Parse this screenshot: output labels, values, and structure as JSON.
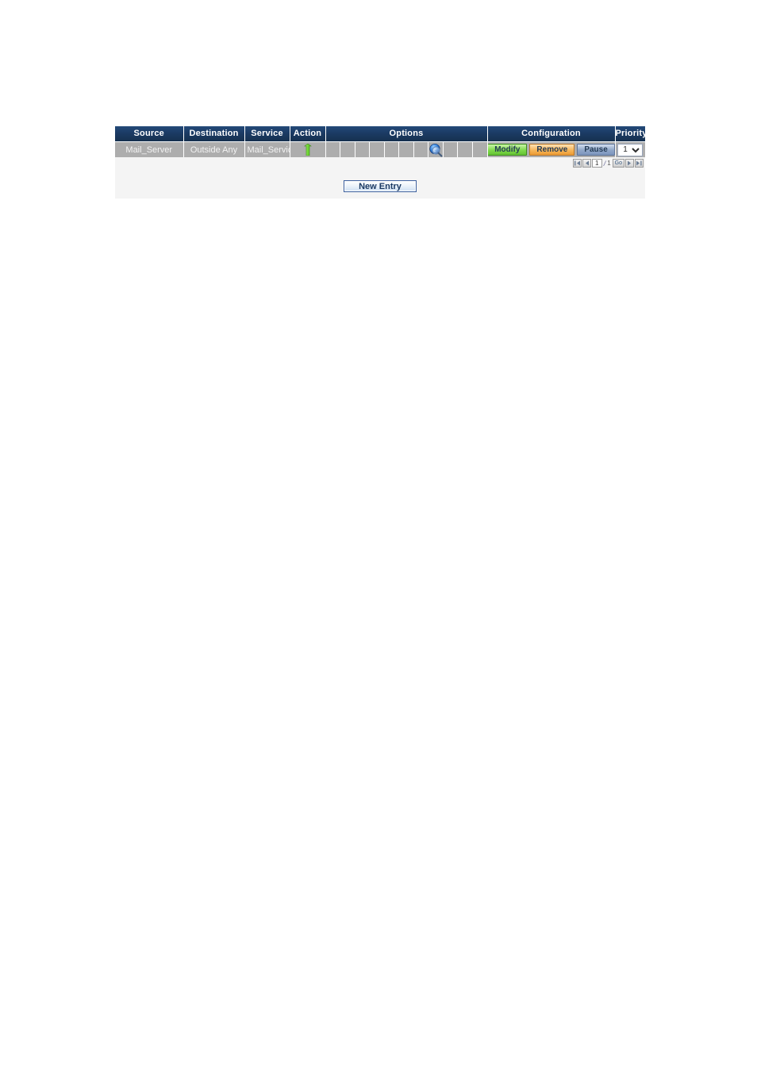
{
  "table": {
    "columns": [
      {
        "key": "source",
        "label": "Source"
      },
      {
        "key": "destination",
        "label": "Destination"
      },
      {
        "key": "service",
        "label": "Service"
      },
      {
        "key": "action",
        "label": "Action"
      },
      {
        "key": "options",
        "label": "Options"
      },
      {
        "key": "configuration",
        "label": "Configuration"
      },
      {
        "key": "priority",
        "label": "Priority"
      }
    ],
    "rows": [
      {
        "source": "Mail_Server",
        "destination": "Outside Any",
        "service": "Mail_Servic...",
        "action_icon": "permit-arrow-icon",
        "options": {
          "cell_count": 11,
          "icon_cell_index": 8,
          "icon": "e-search-icon"
        },
        "configuration": {
          "modify_label": "Modify",
          "remove_label": "Remove",
          "pause_label": "Pause"
        },
        "priority": {
          "value": "1",
          "options": [
            "1"
          ]
        }
      }
    ]
  },
  "pager": {
    "first_icon": "first-page-icon",
    "prev_icon": "prev-page-icon",
    "current_page": "1",
    "separator": "/",
    "total_pages": "1",
    "go_label": "Go",
    "next_icon": "next-page-icon",
    "last_icon": "last-page-icon"
  },
  "footer": {
    "new_entry_label": "New Entry"
  },
  "colors": {
    "header_bg": "#1b3a63",
    "row_bg": "#adadad",
    "panel_bg": "#f4f4f4",
    "modify_green": "#7fd94b",
    "remove_orange": "#f6b65a",
    "pause_blue": "#8fa6c8"
  }
}
